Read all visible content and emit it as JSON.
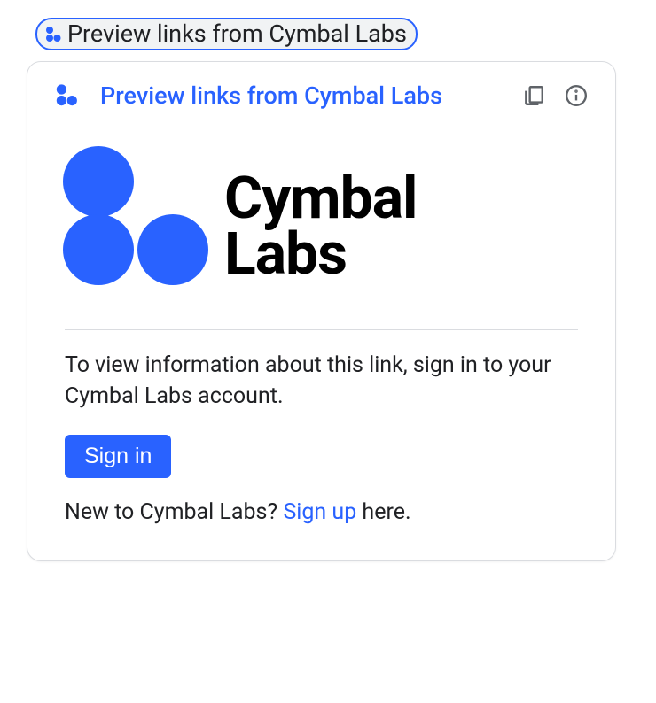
{
  "chip": {
    "label": "Preview links from Cymbal Labs"
  },
  "card": {
    "header": {
      "title": "Preview links from Cymbal Labs"
    },
    "logo": {
      "name": "Cymbal\nLabs"
    },
    "description": "To view information about this link, sign in to your Cymbal Labs account.",
    "signin_button": "Sign in",
    "signup": {
      "prefix": "New to Cymbal Labs? ",
      "link": "Sign up",
      "suffix": " here."
    }
  }
}
